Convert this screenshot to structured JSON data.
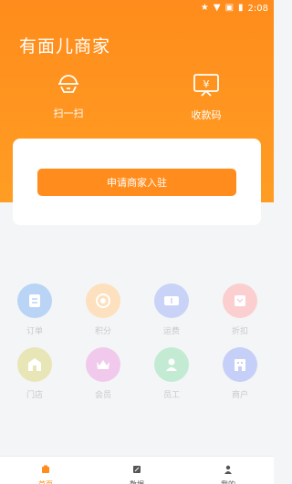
{
  "status_bar": {
    "time": "2:08"
  },
  "header": {
    "title": "有面儿商家"
  },
  "quick_actions": [
    {
      "label": "扫一扫",
      "icon": "scan-icon"
    },
    {
      "label": "收款码",
      "icon": "payment-code-icon"
    }
  ],
  "card": {
    "apply_button_label": "申请商家入驻"
  },
  "grid": [
    {
      "label": "订单",
      "icon": "order-icon",
      "color": "#b9d4f5"
    },
    {
      "label": "积分",
      "icon": "points-icon",
      "color": "#fde0bd"
    },
    {
      "label": "运费",
      "icon": "shipping-icon",
      "color": "#c9d3f7"
    },
    {
      "label": "折扣",
      "icon": "discount-icon",
      "color": "#fbcfcf"
    },
    {
      "label": "门店",
      "icon": "store-icon",
      "color": "#e8e6b6"
    },
    {
      "label": "会员",
      "icon": "member-icon",
      "color": "#f1c9ec"
    },
    {
      "label": "员工",
      "icon": "staff-icon",
      "color": "#c3ebd3"
    },
    {
      "label": "商户",
      "icon": "merchant-icon",
      "color": "#c6cff7"
    }
  ],
  "tabbar": [
    {
      "label": "首页",
      "icon": "home-icon",
      "active": true
    },
    {
      "label": "数据",
      "icon": "data-icon",
      "active": false
    },
    {
      "label": "我的",
      "icon": "profile-icon",
      "active": false
    }
  ],
  "colors": {
    "primary": "#ff8c1c",
    "background": "#f4f5f7"
  }
}
